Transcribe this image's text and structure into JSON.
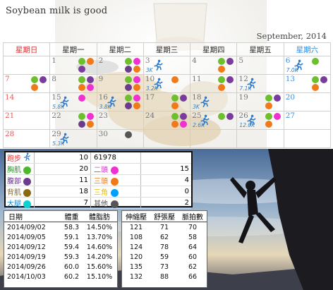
{
  "calendar": {
    "title": "Soybean milk is good",
    "month": "September, 2014",
    "weekdays": [
      "星期日",
      "星期一",
      "星期二",
      "星期三",
      "星期四",
      "星期五",
      "星期六"
    ],
    "weeks": [
      [
        {
          "day": ""
        },
        {
          "day": "1",
          "dots": [
            "#6dbf2d",
            "#f07a1a",
            "#7a3c9a"
          ]
        },
        {
          "day": "2",
          "dots": [
            "#6dbf2d",
            "#f030d0",
            "#6a3c8a",
            "#f07a1a"
          ]
        },
        {
          "day": "3",
          "run": "3K"
        },
        {
          "day": "4",
          "dots": [
            "#6dbf2d",
            "#7a3c9a",
            "#f07a1a"
          ]
        },
        {
          "day": "5"
        },
        {
          "day": "6",
          "run": "7.0K",
          "dots": [
            "#6dbf2d"
          ]
        }
      ],
      [
        {
          "day": "7",
          "dots": [
            "#6dbf2d",
            "#7a3c9a",
            "#f07a1a"
          ]
        },
        {
          "day": "8",
          "dots": [
            "#6dbf2d",
            "#7a3c9a",
            "#f07a1a",
            "#f030d0"
          ]
        },
        {
          "day": "9",
          "dots": [
            "#6dbf2d",
            "#f030d0",
            "#6a3c8a",
            "#f07a1a"
          ]
        },
        {
          "day": "10",
          "run": "3.2K",
          "dots": [
            "#f07a1a"
          ]
        },
        {
          "day": "11",
          "dots": [
            "#6dbf2d",
            "#7a3c9a",
            "#f07a1a"
          ]
        },
        {
          "day": "12",
          "run": "7.1K"
        },
        {
          "day": "13",
          "dots": [
            "#6dbf2d",
            "#7a3c9a",
            "#f07a1a"
          ]
        }
      ],
      [
        {
          "day": "14"
        },
        {
          "day": "15",
          "run": "5.8K",
          "dots": [
            "#f030d0"
          ]
        },
        {
          "day": "16",
          "run": "3.8K",
          "dots": [
            "#6dbf2d",
            "#f030d0",
            "#6a3c8a",
            "#f07a1a"
          ]
        },
        {
          "day": "17",
          "dots": [
            "#6dbf2d",
            "#7a3c9a",
            "#f07a1a"
          ]
        },
        {
          "day": "18",
          "run": "3K"
        },
        {
          "day": "19",
          "dots": [
            "#6dbf2d",
            "#7a3c9a",
            "#f07a1a"
          ]
        },
        {
          "day": "20"
        }
      ],
      [
        {
          "day": "21"
        },
        {
          "day": "22",
          "dots": [
            "#6dbf2d",
            "#f030d0",
            "#6a3c8a",
            "#f07a1a"
          ]
        },
        {
          "day": "23"
        },
        {
          "day": "24",
          "dots": [
            "#6dbf2d",
            "#7a3c9a",
            "#f07a1a",
            "#f030d0"
          ]
        },
        {
          "day": "25",
          "run": "2.6K",
          "dots": [
            "#6dbf2d",
            "#7a3c9a"
          ]
        },
        {
          "day": "26",
          "run": "12.0K",
          "dots": [
            "#6dbf2d",
            "#f030d0",
            "#f07a1a"
          ]
        },
        {
          "day": "27"
        }
      ],
      [
        {
          "day": "28"
        },
        {
          "day": "29",
          "run": "5.3K"
        },
        {
          "day": "30",
          "dots": [
            "#555555"
          ]
        },
        {
          "day": ""
        },
        {
          "day": ""
        },
        {
          "day": ""
        },
        {
          "day": ""
        }
      ]
    ]
  },
  "legend": {
    "rows": [
      {
        "left_label": "跑步",
        "left_color": "#e03030",
        "left_icon": "running-icon",
        "left_value": "10",
        "right_label": "",
        "right_color": "#3a3a3a",
        "right_icon": "",
        "right_value": "61978",
        "right_dot": ""
      },
      {
        "left_label": "胸肌",
        "left_color": "#2a9a2a",
        "left_icon": "green-dot-icon",
        "left_dot": "#4db82b",
        "left_value": "20",
        "right_label": "二頭",
        "right_color": "#e030d0",
        "right_dot": "#f030d0",
        "right_icon": "magenta-dot-icon",
        "right_value": "15"
      },
      {
        "left_label": "腹部",
        "left_color": "#6a2c9a",
        "left_icon": "purple-dot-icon",
        "left_dot": "#6a3c8a",
        "left_value": "11",
        "right_label": "三頭",
        "right_color": "#f07a1a",
        "right_dot": "#f07a1a",
        "right_icon": "orange-dot-icon",
        "right_value": "4"
      },
      {
        "left_label": "背肌",
        "left_color": "#8a6a2a",
        "left_icon": "brown-dot-icon",
        "left_dot": "#8a6a10",
        "left_value": "18",
        "right_label": "三角",
        "right_color": "#e8c000",
        "right_dot": "#00a0ff",
        "right_icon": "blue-dot-icon",
        "right_value": "0"
      },
      {
        "left_label": "大腿",
        "left_color": "#1a8ad0",
        "left_icon": "cyan-dot-icon",
        "left_dot": "#11d0d0",
        "left_value": "7",
        "right_label": "其他",
        "right_color": "#555555",
        "right_dot": "#555555",
        "right_icon": "gray-dot-icon",
        "right_value": "2"
      }
    ]
  },
  "weight_table": {
    "headers": [
      "日期",
      "體重",
      "體脂肪"
    ],
    "rows": [
      [
        "2014/09/02",
        "58.3",
        "14.50%"
      ],
      [
        "2014/09/05",
        "59.1",
        "13.70%"
      ],
      [
        "2014/09/12",
        "59.4",
        "14.60%"
      ],
      [
        "2014/09/19",
        "59.3",
        "14.20%"
      ],
      [
        "2014/09/26",
        "60.0",
        "15.60%"
      ],
      [
        "2014/10/03",
        "60.2",
        "15.10%"
      ]
    ]
  },
  "bp_table": {
    "headers": [
      "伸縮壓",
      "舒張壓",
      "脈拍數"
    ],
    "rows": [
      [
        "121",
        "71",
        "70"
      ],
      [
        "108",
        "62",
        "58"
      ],
      [
        "124",
        "78",
        "64"
      ],
      [
        "120",
        "59",
        "60"
      ],
      [
        "135",
        "73",
        "62"
      ],
      [
        "132",
        "88",
        "66"
      ]
    ]
  }
}
